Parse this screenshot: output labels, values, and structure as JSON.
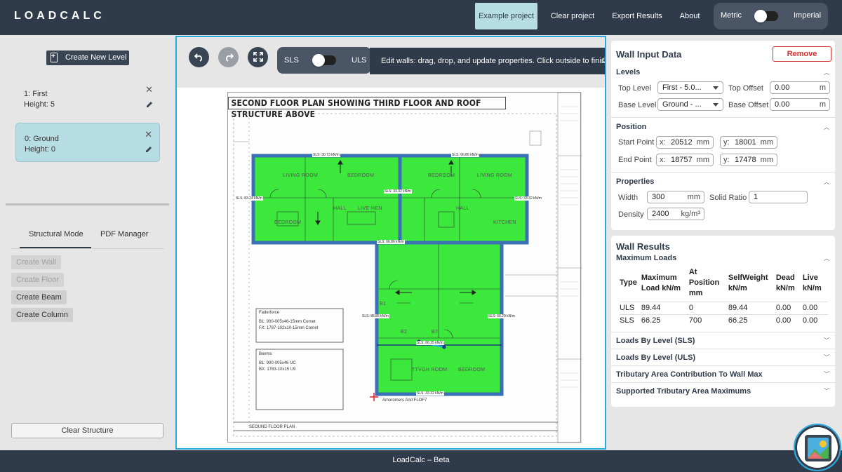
{
  "header": {
    "logo": "LOADCALC",
    "nav": [
      "Example project",
      "Clear project",
      "Export Results",
      "About"
    ],
    "units": {
      "left": "Metric",
      "right": "Imperial"
    }
  },
  "sidebar": {
    "create_level": "Create New Level",
    "levels": [
      {
        "name": "1: First",
        "height": "Height: 5"
      },
      {
        "name": "0: Ground",
        "height": "Height: 0"
      }
    ],
    "tabs": [
      "Structural Mode",
      "PDF Manager"
    ],
    "tools": [
      "Create Wall",
      "Create Floor",
      "Create Beam",
      "Create Column"
    ],
    "clear": "Clear Structure"
  },
  "canvas": {
    "load_toggle": {
      "left": "SLS",
      "right": "ULS"
    },
    "tooltip": "Edit walls: drag, drop, and update properties. Click outside to finish.",
    "tooltip_tail": "C",
    "plan_title": "SECOND FLOOR PLAN SHOWING THIRD FLOOR AND ROOF STRUCTURE ABOVE",
    "rooms": [
      "LIVING ROOM",
      "BEDROOM",
      "BEDROOM",
      "LIVING ROOM",
      "HALL",
      "LIVE-HEN",
      "HALL",
      "BEDROOM",
      "KITCHEN",
      "B1",
      "B2",
      "B7",
      "TTVGH ROOM",
      "BEDROOM"
    ],
    "wall_labels": [
      "SLS: 30.73 kN/m",
      "SLS: 66.86 kN/m",
      "SLS: 33.32 kN/m",
      "SLS: 83.24 kN/m",
      "SLS: 33.32 kN/m",
      "SLS: 66.86 kN/m",
      "SLS: 86.85 kN/m",
      "SLS: 66.29 kN/m",
      "SLS: 66.25 kN/m",
      "SLS: 33.32 kN/m"
    ],
    "notes": {
      "fader_title": "Faderforce",
      "fader_1": "B1:  900-005x46-15mm Cornet",
      "fader_2": "FX:  1787-102x10-15mm Cornet",
      "beams_title": "Beems",
      "beams_1": "B1:  900-005x46 UC",
      "beams_2": "BX:  1783-10x15 U9",
      "plan_footer": "SEOUND FLOOR PLAN",
      "plan_sub": "Amoromers And FLOF7"
    }
  },
  "wall_input": {
    "title": "Wall Input Data",
    "remove": "Remove",
    "levels_title": "Levels",
    "top_level_label": "Top Level",
    "top_level_value": "First - 5.0...",
    "top_offset_label": "Top Offset",
    "top_offset_value": "0.00",
    "base_level_label": "Base Level",
    "base_level_value": "Ground - ...",
    "base_offset_label": "Base Offset",
    "base_offset_value": "0.00",
    "offset_unit": "m",
    "position_title": "Position",
    "start_label": "Start Point",
    "start_x": "20512",
    "start_y": "18001",
    "end_label": "End Point",
    "end_x": "18757",
    "end_y": "17478",
    "x_prefix": "x:",
    "y_prefix": "y:",
    "mm": "mm",
    "properties_title": "Properties",
    "width_label": "Width",
    "width_value": "300",
    "solid_label": "Solid Ratio",
    "solid_value": "1",
    "density_label": "Density",
    "density_value": "2400",
    "density_unit": "kg/m³"
  },
  "wall_results": {
    "title": "Wall Results",
    "max_title": "Maximum Loads",
    "headers": [
      "Type",
      "Maximum Load kN/m",
      "At Position mm",
      "SelfWeight kN/m",
      "Dead kN/m",
      "Live kN/m"
    ],
    "rows": [
      [
        "ULS",
        "89.44",
        "0",
        "89.44",
        "0.00",
        "0.00"
      ],
      [
        "SLS",
        "66.25",
        "700",
        "66.25",
        "0.00",
        "0.00"
      ]
    ],
    "sections": [
      "Loads By Level (SLS)",
      "Loads By Level (ULS)",
      "Tributary Area Contribution To Wall Max",
      "Supported Tributary Area Maximums"
    ]
  },
  "footer": {
    "text": "LoadCalc – Beta"
  },
  "colors": {
    "header": "#2f3a4b",
    "accent": "#29a8e0",
    "room": "#3ce83c",
    "wall": "#3b6fb6",
    "danger": "#d32f2f"
  }
}
